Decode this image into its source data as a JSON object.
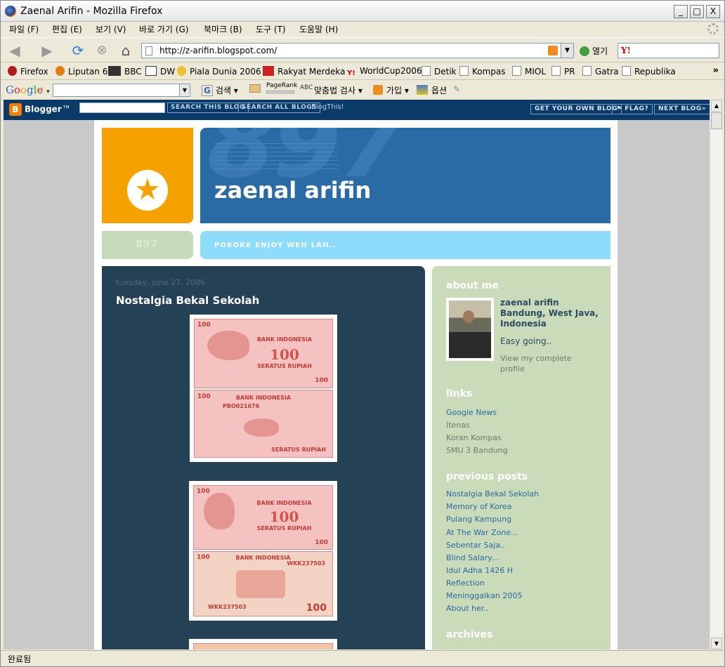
{
  "window": {
    "title": "Zaenal Arifin - Mozilla Firefox",
    "minimize": "_",
    "maximize": "□",
    "close": "X"
  },
  "menu": [
    "파일 (F)",
    "편집 (E)",
    "보기 (V)",
    "바로 가기 (G)",
    "북마크 (B)",
    "도구 (T)",
    "도움말 (H)"
  ],
  "nav": {
    "url": "http://z-arifin.blogspot.com/",
    "go_label": "열기"
  },
  "bookmarks": [
    "Firefox",
    "Liputan 6",
    "BBC",
    "DW",
    "Piala Dunia 2006",
    "Rakyat Merdeka",
    "WorldCup2006",
    "Detik",
    "Kompas",
    "MIOL",
    "PR",
    "Gatra",
    "Republika"
  ],
  "google_toolbar": {
    "logo": "Google",
    "search_label": "검색",
    "pagerank_label": "PageRank",
    "spell_label": "맞춤법 검사",
    "signup_label": "가입",
    "options_label": "옵션"
  },
  "blogger_bar": {
    "logo": "Blogger",
    "search_this": "SEARCH THIS BLOG",
    "search_all": "SEARCH ALL BLOGS",
    "blogthis": "BlogThis!",
    "get_own": "GET YOUR OWN BLOG",
    "flag": "FLAG?",
    "next_blog": "NEXT BLOG»"
  },
  "blog": {
    "title": "zaenal arifin",
    "header_number": "897",
    "sub_number": "897",
    "description": "POKOKE ENJOY WEH LAH..",
    "colors": {
      "orange": "#f5a100",
      "blue": "#2a6aa5",
      "cyan": "#8edcfb",
      "green": "#c6dbb9",
      "main": "#254156"
    }
  },
  "post": {
    "date": "tuesday, june 27, 2006",
    "title": "Nostalgia Bekal Sekolah",
    "notes": [
      {
        "value": "100",
        "bank": "BANK INDONESIA",
        "words": "SERATUS RUPIAH",
        "serial": "PBO021676"
      },
      {
        "value": "100",
        "bank": "BANK INDONESIA",
        "words": "SERATUS RUPIAH",
        "serial": "WKK237503"
      }
    ]
  },
  "sidebar": {
    "about_title": "about me",
    "name": "zaenal arifin",
    "location": "Bandung, West Java, Indonesia",
    "bio": "Easy going..",
    "view_profile": "View my complete profile",
    "links_title": "links",
    "links": [
      "Google News",
      "Itenas",
      "Koran Kompas",
      "SMU 3 Bandung"
    ],
    "previous_title": "previous posts",
    "previous_posts": [
      "Nostalgia Bekal Sekolah",
      "Memory of Korea",
      "Pulang Kampung",
      "At The War Zone...",
      "Sebentar Saja..",
      "Blind Salary...",
      "Idul Adha 1426 H",
      "Reflection",
      "Meninggalkan 2005",
      "About her.."
    ],
    "archives_title": "archives"
  },
  "status": "완료됨"
}
